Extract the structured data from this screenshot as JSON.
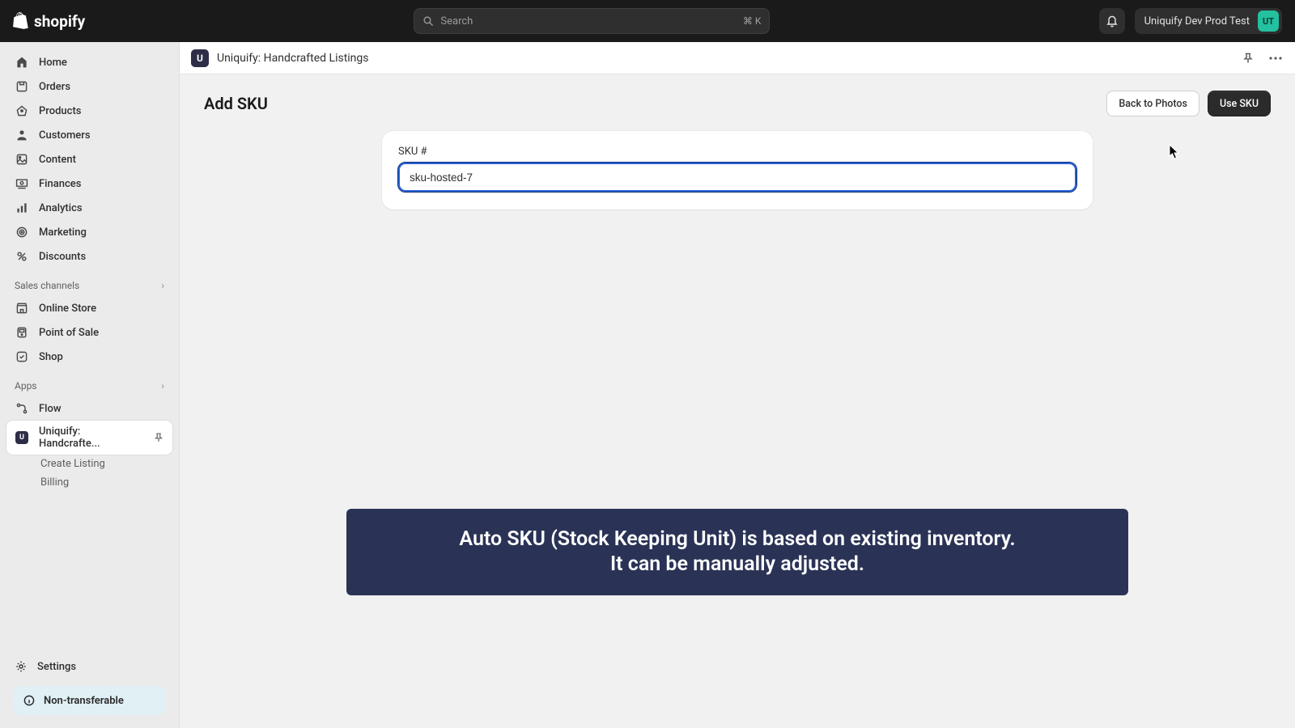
{
  "brand": "shopify",
  "search": {
    "placeholder": "Search",
    "kbd": "⌘ K"
  },
  "store": {
    "name": "Uniquify Dev Prod Test",
    "initials": "UT"
  },
  "nav": {
    "home": "Home",
    "orders": "Orders",
    "products": "Products",
    "customers": "Customers",
    "content": "Content",
    "finances": "Finances",
    "analytics": "Analytics",
    "marketing": "Marketing",
    "discounts": "Discounts"
  },
  "sections": {
    "sales": "Sales channels",
    "apps": "Apps"
  },
  "channels": {
    "online": "Online Store",
    "pos": "Point of Sale",
    "shop": "Shop"
  },
  "apps": {
    "flow": "Flow",
    "uniquify": "Uniquify: Handcrafte...",
    "sub_create": "Create Listing",
    "sub_billing": "Billing"
  },
  "settings": "Settings",
  "nontransferable": "Non-transferable",
  "app_header": {
    "title": "Uniquify: Handcrafted Listings"
  },
  "page": {
    "title": "Add SKU",
    "back_btn": "Back to Photos",
    "use_btn": "Use SKU",
    "field_label": "SKU #",
    "field_value": "sku-hosted-7"
  },
  "banner": {
    "line1": "Auto SKU (Stock Keeping Unit) is based on existing inventory.",
    "line2": "It can be manually adjusted."
  }
}
